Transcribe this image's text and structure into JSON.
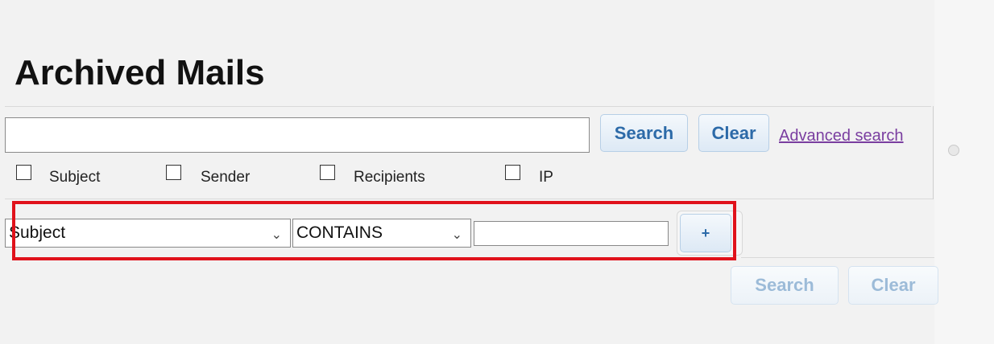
{
  "page": {
    "title": "Archived Mails"
  },
  "simple_search": {
    "input_value": "",
    "search_label": "Search",
    "clear_label": "Clear",
    "advanced_link": "Advanced search",
    "checkboxes": [
      {
        "label": "Subject",
        "checked": false
      },
      {
        "label": "Sender",
        "checked": false
      },
      {
        "label": "Recipients",
        "checked": false
      },
      {
        "label": "IP",
        "checked": false
      }
    ]
  },
  "advanced_row": {
    "field_select": "Subject",
    "operator_select": "CONTAINS",
    "value_input": "",
    "add_label": "+"
  },
  "advanced_actions": {
    "search_label": "Search",
    "clear_label": "Clear"
  },
  "colors": {
    "highlight": "#e0121b",
    "button_text": "#2c6aa8",
    "link": "#7a3ea0"
  }
}
